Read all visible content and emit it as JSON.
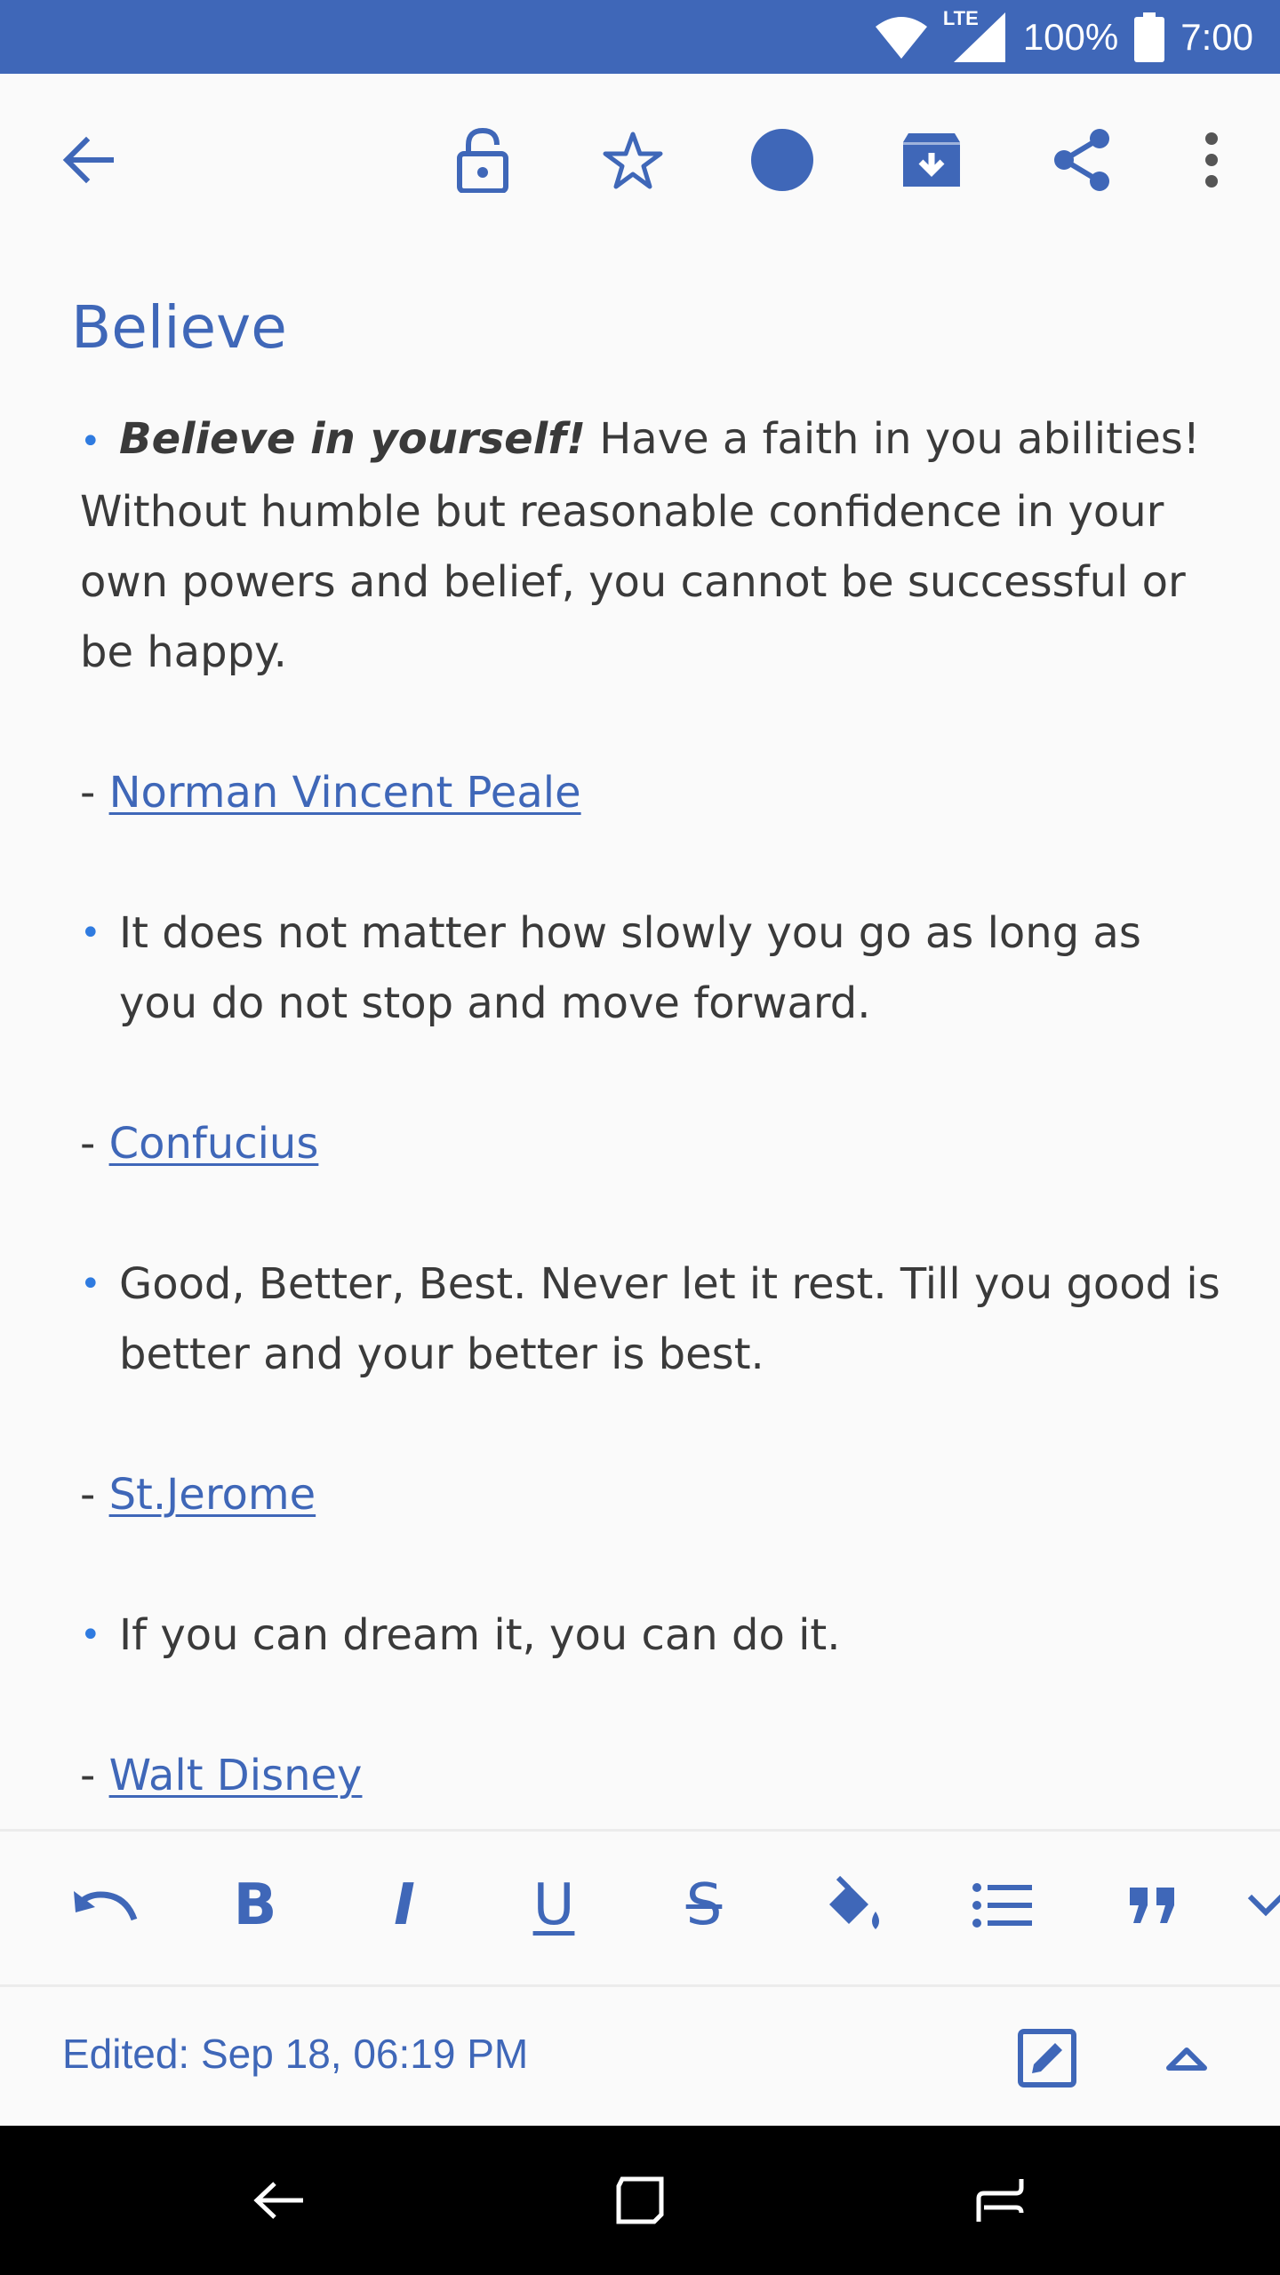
{
  "status_bar": {
    "network": "LTE",
    "battery": "100%",
    "time": "7:00"
  },
  "toolbar": {
    "icons": [
      "back-arrow-icon",
      "lock-open-icon",
      "star-outline-icon",
      "color-dot-icon",
      "archive-icon",
      "share-icon",
      "more-vert-icon"
    ]
  },
  "note": {
    "title": "Believe",
    "items": [
      {
        "bold_lead": "Believe in yourself!",
        "text": " Have a faith in you abilities! Without humble but reasonable confidence in your own powers and belief, you cannot be successful or be happy.",
        "author_prefix": "- ",
        "author": "Norman Vincent Peale"
      },
      {
        "text": "It does not matter how slowly you go as long as you do not stop and move forward.",
        "author_prefix": "- ",
        "author": "Confucius"
      },
      {
        "text": "Good, Better, Best. Never let it rest. Till you good is better and your better is best.",
        "author_prefix": "- ",
        "author": "St.Jerome"
      },
      {
        "text": "If you can dream it, you can do it.",
        "author_prefix": "- ",
        "author": "Walt Disney"
      }
    ]
  },
  "format_bar": {
    "bold": "B",
    "italic": "I",
    "underline": "U",
    "strike": "S",
    "icons": [
      "undo-icon",
      "bold-icon",
      "italic-icon",
      "underline-icon",
      "strikethrough-icon",
      "fill-color-icon",
      "bullet-list-icon",
      "quote-icon"
    ]
  },
  "footer": {
    "edited": "Edited: Sep 18, 06:19 PM"
  },
  "colors": {
    "accent": "#3f67b8",
    "bullet": "#2f7be0",
    "text": "#3a3a3a"
  }
}
